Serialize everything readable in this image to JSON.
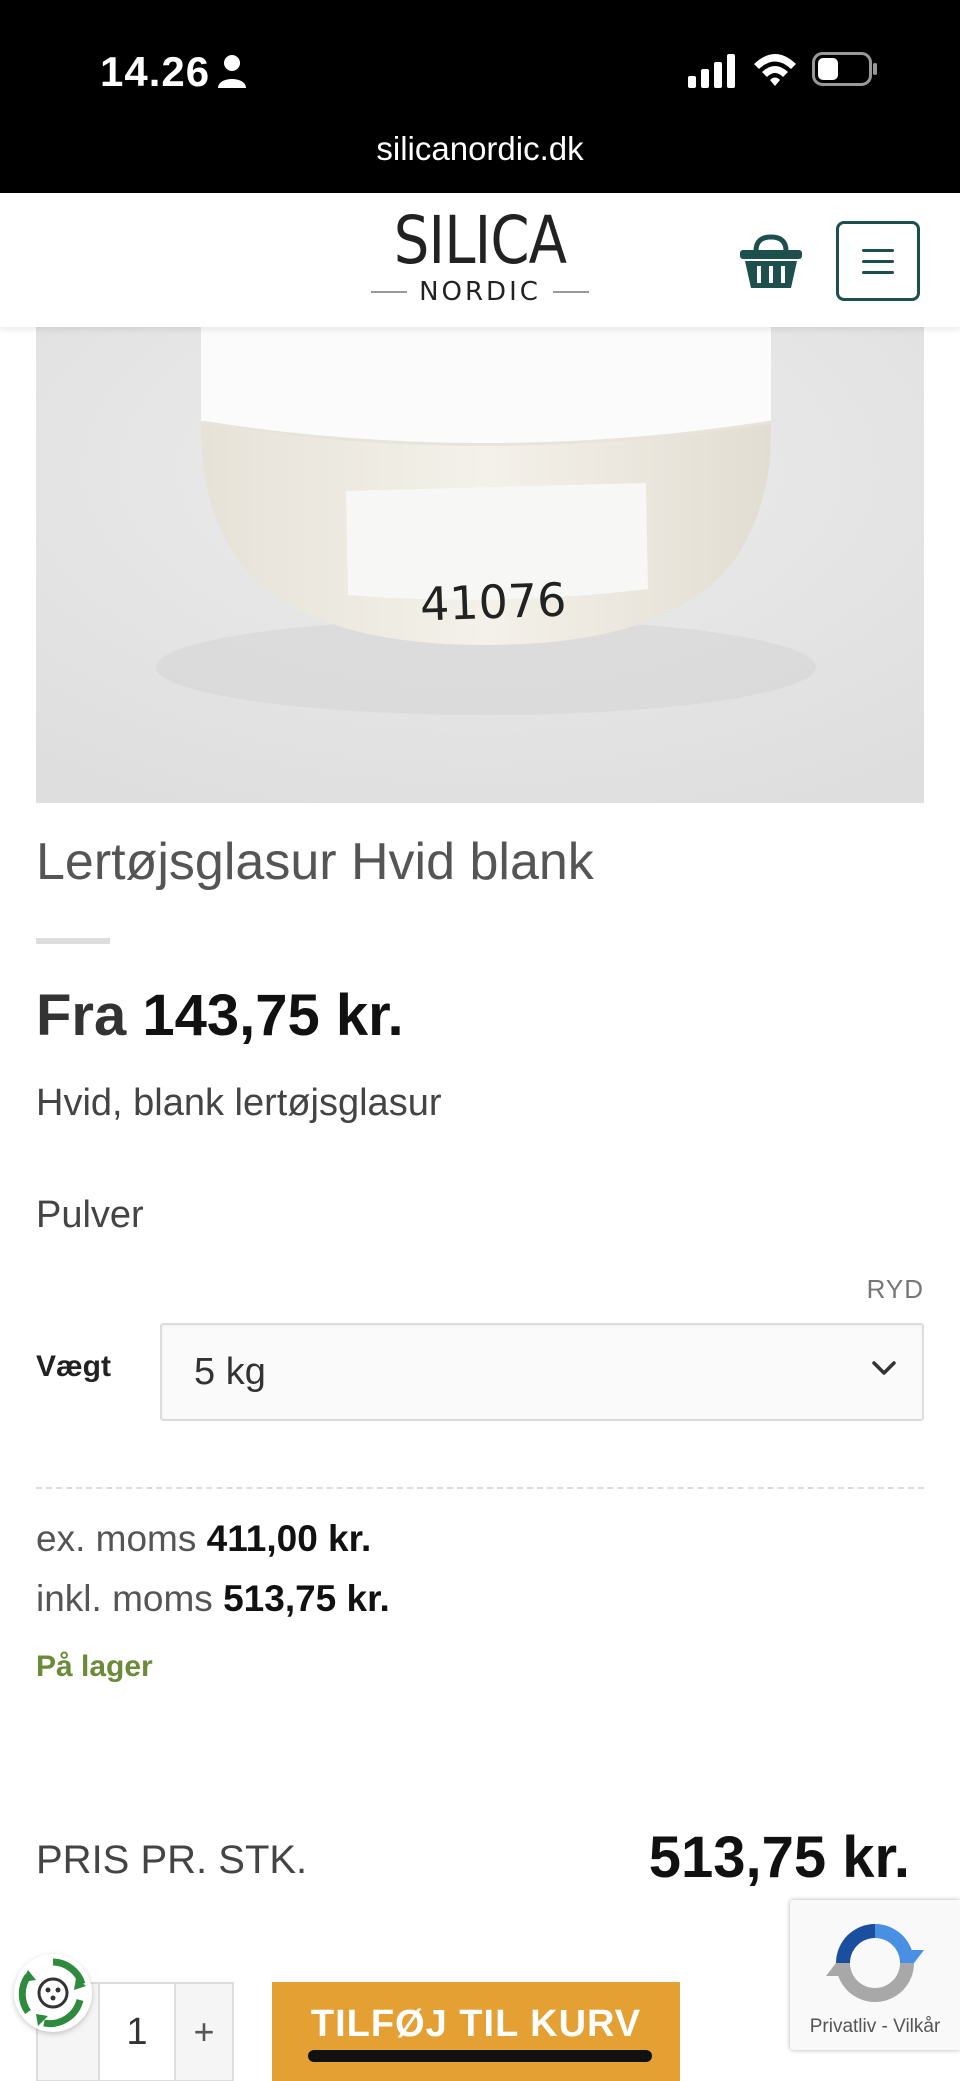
{
  "status_bar": {
    "time": "14.26",
    "url": "silicanordic.dk"
  },
  "header": {
    "logo_main": "SILICA",
    "logo_sub": "NORDIC"
  },
  "product": {
    "image_label": "41076",
    "title": "Lertøjsglasur Hvid blank",
    "price_prefix": "Fra",
    "price_from": "143,75 kr.",
    "description": "Hvid, blank lertøjsglasur",
    "form": "Pulver",
    "clear_label": "RYD",
    "weight_label": "Vægt",
    "weight_selected": "5 kg",
    "ex_moms_label": "ex. moms",
    "ex_moms_value": "411,00 kr.",
    "incl_moms_label": "inkl. moms",
    "incl_moms_value": "513,75 kr.",
    "stock": "På lager",
    "unit_price_label": "PRIS PR. STK.",
    "unit_price_value": "513,75 kr."
  },
  "cart_form": {
    "quantity": "1",
    "plus": "+",
    "add_to_cart": "TILFØJ TIL KURV"
  },
  "recaptcha": {
    "links": "Privatliv - Vilkår"
  },
  "colors": {
    "accent": "#e4a033",
    "brand": "#1d4f4c",
    "stock": "#6b8b3a"
  }
}
